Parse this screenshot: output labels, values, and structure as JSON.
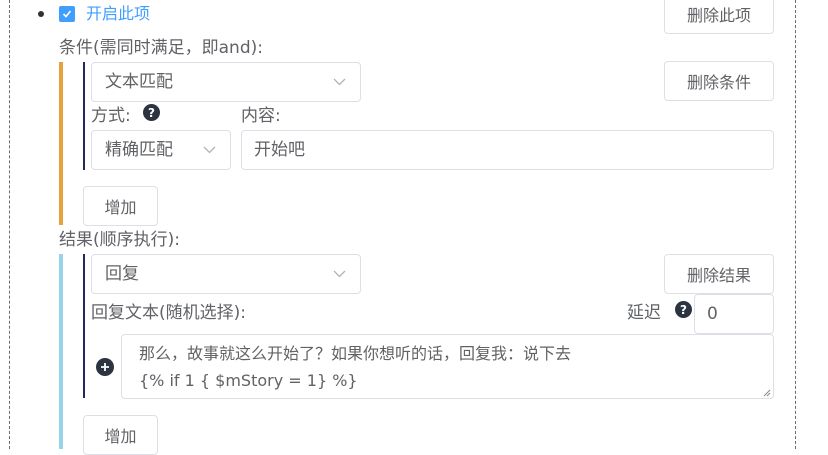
{
  "header": {
    "enable_label": "开启此项",
    "delete_item": "删除此项"
  },
  "conditions": {
    "title": "条件(需同时满足，即and):",
    "type_value": "文本匹配",
    "delete_label": "删除条件",
    "mode_label": "方式:",
    "mode_help": "?",
    "mode_value": "精确匹配",
    "content_label": "内容:",
    "content_value": "开始吧",
    "add_label": "增加"
  },
  "results": {
    "title": "结果(顺序执行):",
    "type_value": "回复",
    "delete_label": "删除结果",
    "reply_label": "回复文本(随机选择):",
    "delay_label": "延迟",
    "delay_help": "?",
    "delay_value": "0",
    "reply_text": "那么，故事就这么开始了？如果你想听的话，回复我：说下去\n{% if 1 { $mStory = 1} %}",
    "add_label": "增加"
  },
  "colors": {
    "accent": "#409eff",
    "condition_bar": "#e6a23c",
    "result_bar": "#99d3ea",
    "inner_bar": "#1f2a5a",
    "border": "#dcdfe6",
    "text": "#606266"
  },
  "icons": [
    "check-icon",
    "chevron-down-icon",
    "help-icon",
    "plus-circle-icon",
    "resize-grip-icon"
  ]
}
